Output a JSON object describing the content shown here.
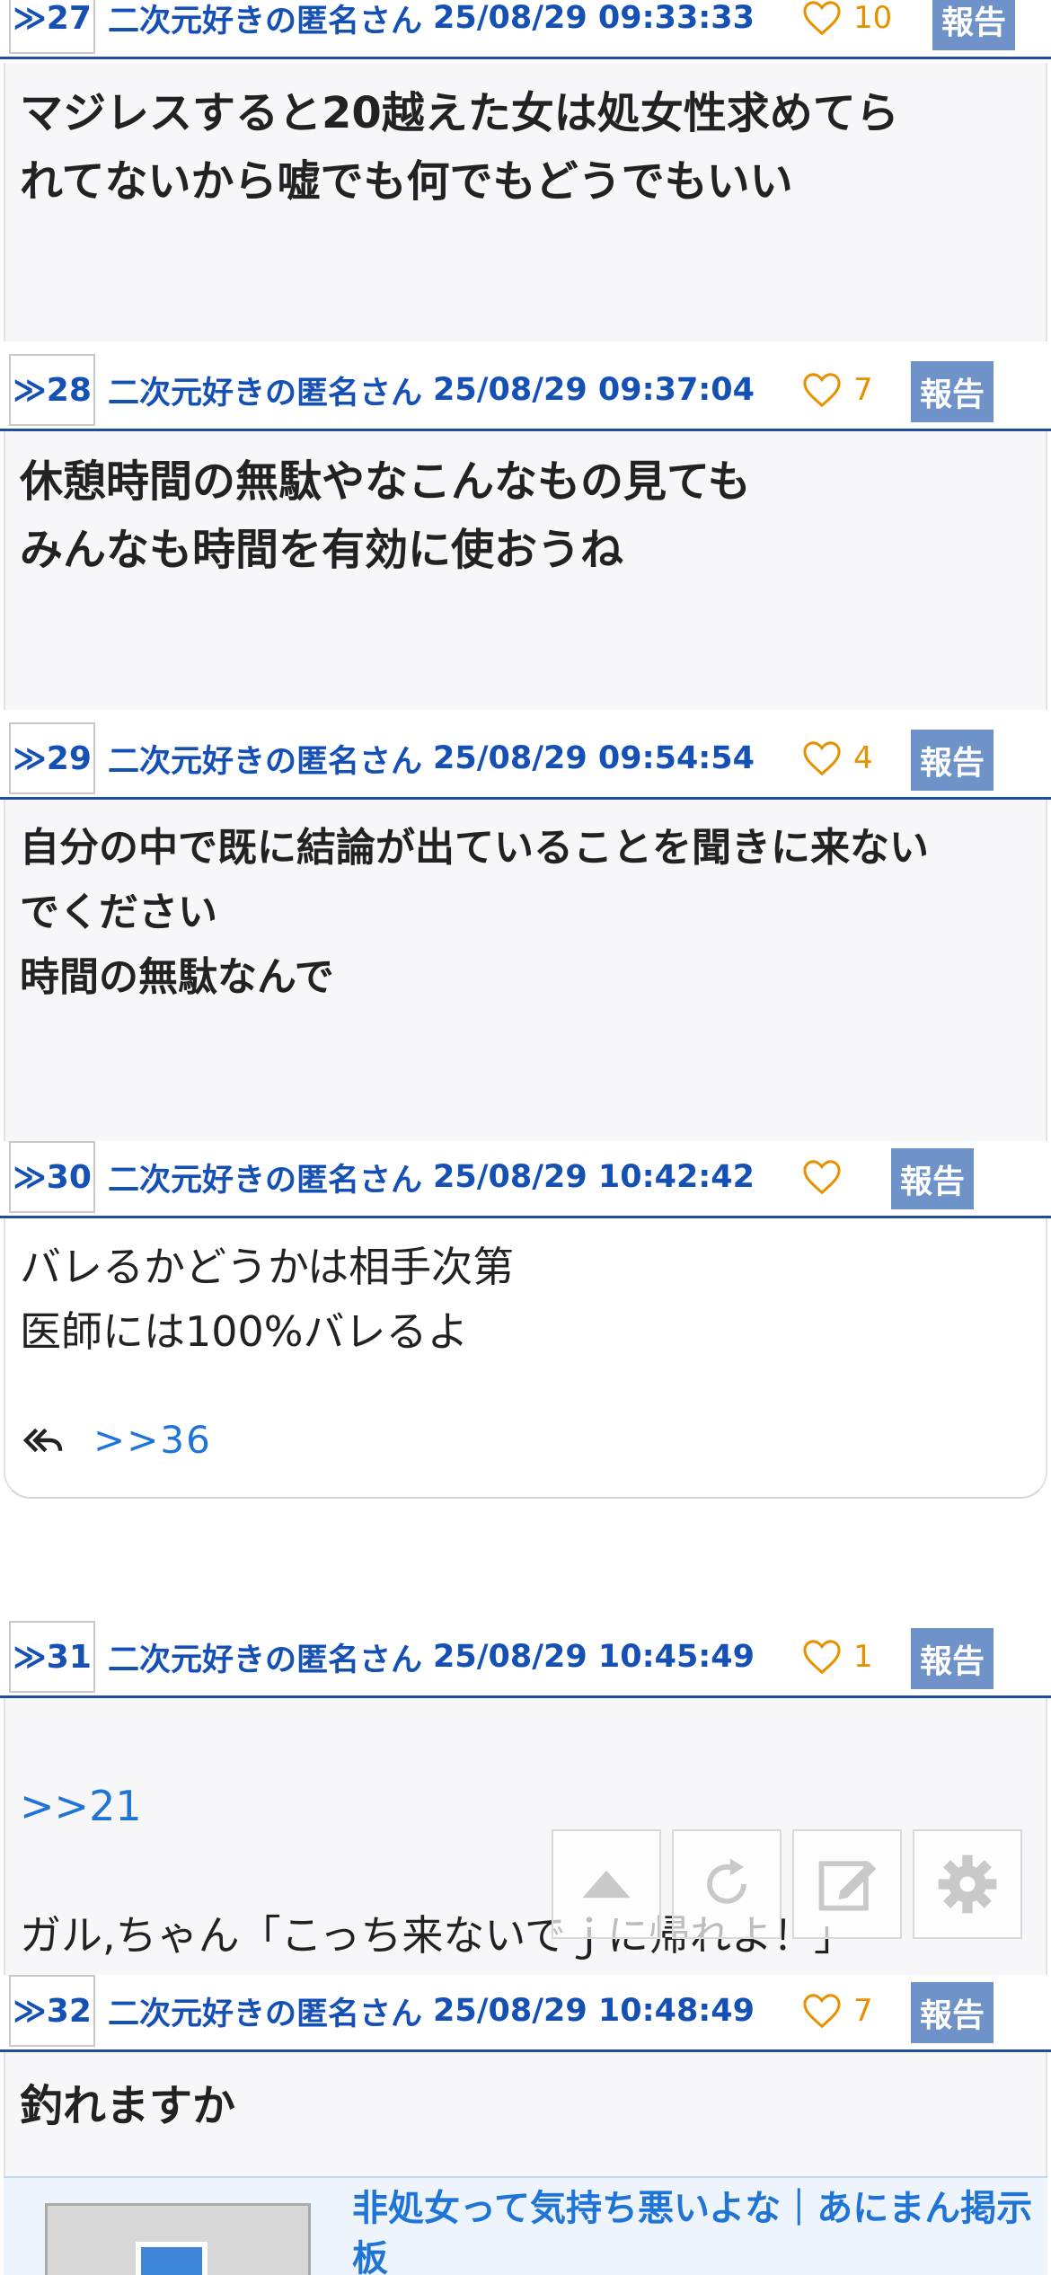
{
  "posts": [
    {
      "number": "≫27",
      "name": "二次元好きの匿名さん",
      "date": "25/08/29 09:33:33",
      "likes": "10",
      "report_label": "報告",
      "body": "マジレスすると20越えた女は処女性求めてら\nれてないから嘘でも何でもどうでもいい"
    },
    {
      "number": "≫28",
      "name": "二次元好きの匿名さん",
      "date": "25/08/29 09:37:04",
      "likes": "7",
      "report_label": "報告",
      "body": "休憩時間の無駄やなこんなもの見ても\nみんなも時間を有効に使おうね"
    },
    {
      "number": "≫29",
      "name": "二次元好きの匿名さん",
      "date": "25/08/29 09:54:54",
      "likes": "4",
      "report_label": "報告",
      "body": "自分の中で既に結論が出ていることを聞きに来ない\nでください\n時間の無駄なんで"
    },
    {
      "number": "≫30",
      "name": "二次元好きの匿名さん",
      "date": "25/08/29 10:42:42",
      "likes": "",
      "report_label": "報告",
      "body": "バレるかどうかは相手次第\n医師には100%バレるよ",
      "reply_anchor": ">>36"
    },
    {
      "number": "≫31",
      "name": "二次元好きの匿名さん",
      "date": "25/08/29 10:45:49",
      "likes": "1",
      "report_label": "報告",
      "anchor": ">>21",
      "body": "ガル,ちゃん「こっち来ないでｊに帰れよ！」"
    },
    {
      "number": "≫32",
      "name": "二次元好きの匿名さん",
      "date": "25/08/29 10:48:49",
      "likes": "7",
      "report_label": "報告",
      "body": "釣れますか"
    }
  ],
  "floating_buttons": [
    {
      "icon": "arrow-up-icon"
    },
    {
      "icon": "reload-icon"
    },
    {
      "icon": "edit-icon"
    },
    {
      "icon": "gear-icon"
    }
  ],
  "link_card": {
    "title": "非処女って気持ち悪いよな｜あにまん掲示板"
  },
  "colors": {
    "header_text": "#1550b4",
    "like": "#e69100",
    "report_bg": "#6f93c9",
    "rule": "#1f4e9a",
    "anchor": "#1f74d6"
  }
}
